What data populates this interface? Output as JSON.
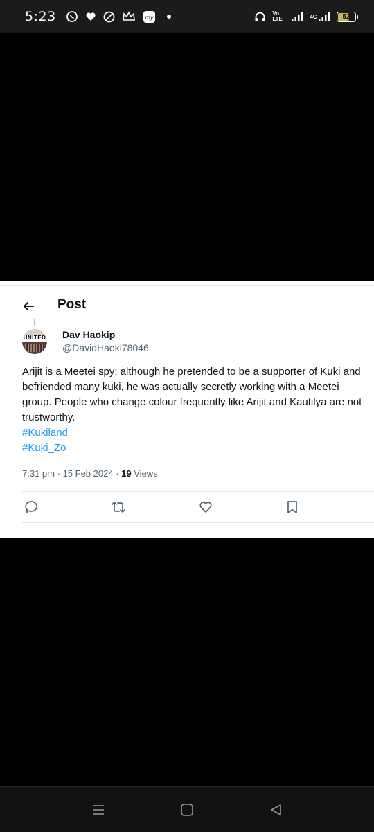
{
  "status_bar": {
    "time": "5:23",
    "network_label": "Vo LTE",
    "network_type": "4G",
    "battery": "52"
  },
  "post": {
    "header_title": "Post",
    "author": {
      "display_name": "Dav Haokip",
      "handle": "@DavidHaoki78046",
      "avatar_text": "UNITED"
    },
    "text": "Arijit is a Meetei spy; although he pretended to be a supporter of Kuki and befriended many kuki, he was actually secretly working with a Meetei group. People who change colour frequently like Arijit and Kautilya are not trustworthy.",
    "hashtags": [
      "#Kukiland",
      "#Kuki_Zo"
    ],
    "time": "7:31 pm",
    "date": "15 Feb 2024",
    "views_count": "19",
    "views_label": "Views",
    "actions": [
      "reply-icon",
      "retweet-icon",
      "like-icon",
      "bookmark-icon"
    ],
    "link_color": "#1d9bf0"
  },
  "nav_bar": {
    "buttons": [
      "menu-icon",
      "home-icon",
      "back-icon"
    ]
  }
}
